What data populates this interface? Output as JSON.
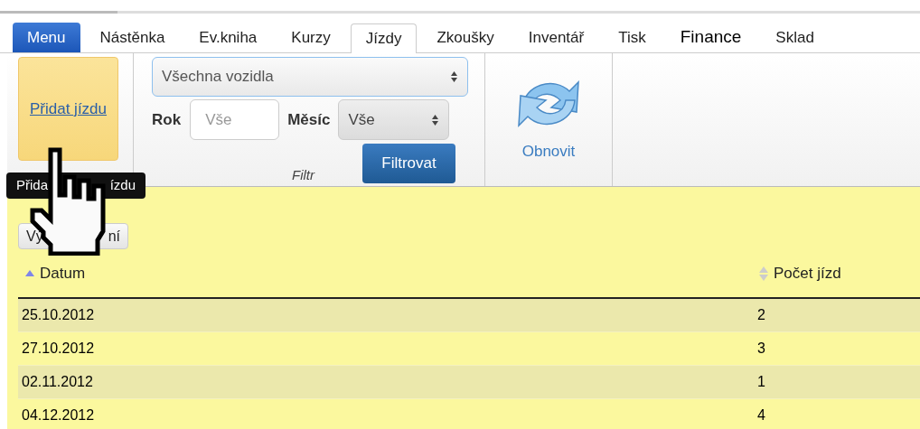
{
  "tabs": [
    {
      "label": "Menu",
      "kind": "menu",
      "selected": false
    },
    {
      "label": "Nástěnka",
      "kind": "tab",
      "selected": false
    },
    {
      "label": "Ev.kniha",
      "kind": "tab",
      "selected": false
    },
    {
      "label": "Kurzy",
      "kind": "tab",
      "selected": false
    },
    {
      "label": "Jízdy",
      "kind": "tab",
      "selected": true
    },
    {
      "label": "Zkoušky",
      "kind": "tab",
      "selected": false
    },
    {
      "label": "Inventář",
      "kind": "tab",
      "selected": false
    },
    {
      "label": "Tisk",
      "kind": "tab",
      "selected": false
    },
    {
      "label": "Finance",
      "kind": "strong",
      "selected": false
    },
    {
      "label": "Sklad",
      "kind": "tab",
      "selected": false
    }
  ],
  "toolbar": {
    "add_button": "Přidat jízdu",
    "tooltip_parts": [
      "Přida",
      "ízdu"
    ],
    "filter": {
      "vehicle_select": "Všechna vozidla",
      "year_label": "Rok",
      "year_placeholder": "Vše",
      "month_label": "Měsíc",
      "month_select": "Vše",
      "filter_button": "Filtrovat",
      "group_label": "Filtr"
    },
    "refresh_button": "Obnovit"
  },
  "report_button_parts": [
    "Vý",
    "ní"
  ],
  "table": {
    "columns": [
      {
        "label": "Datum",
        "sorted": true
      },
      {
        "label": "Počet jízd",
        "sorted": false
      }
    ],
    "rows": [
      [
        "25.10.2012",
        "2"
      ],
      [
        "27.10.2012",
        "3"
      ],
      [
        "02.11.2012",
        "1"
      ],
      [
        "04.12.2012",
        "4"
      ]
    ]
  }
}
